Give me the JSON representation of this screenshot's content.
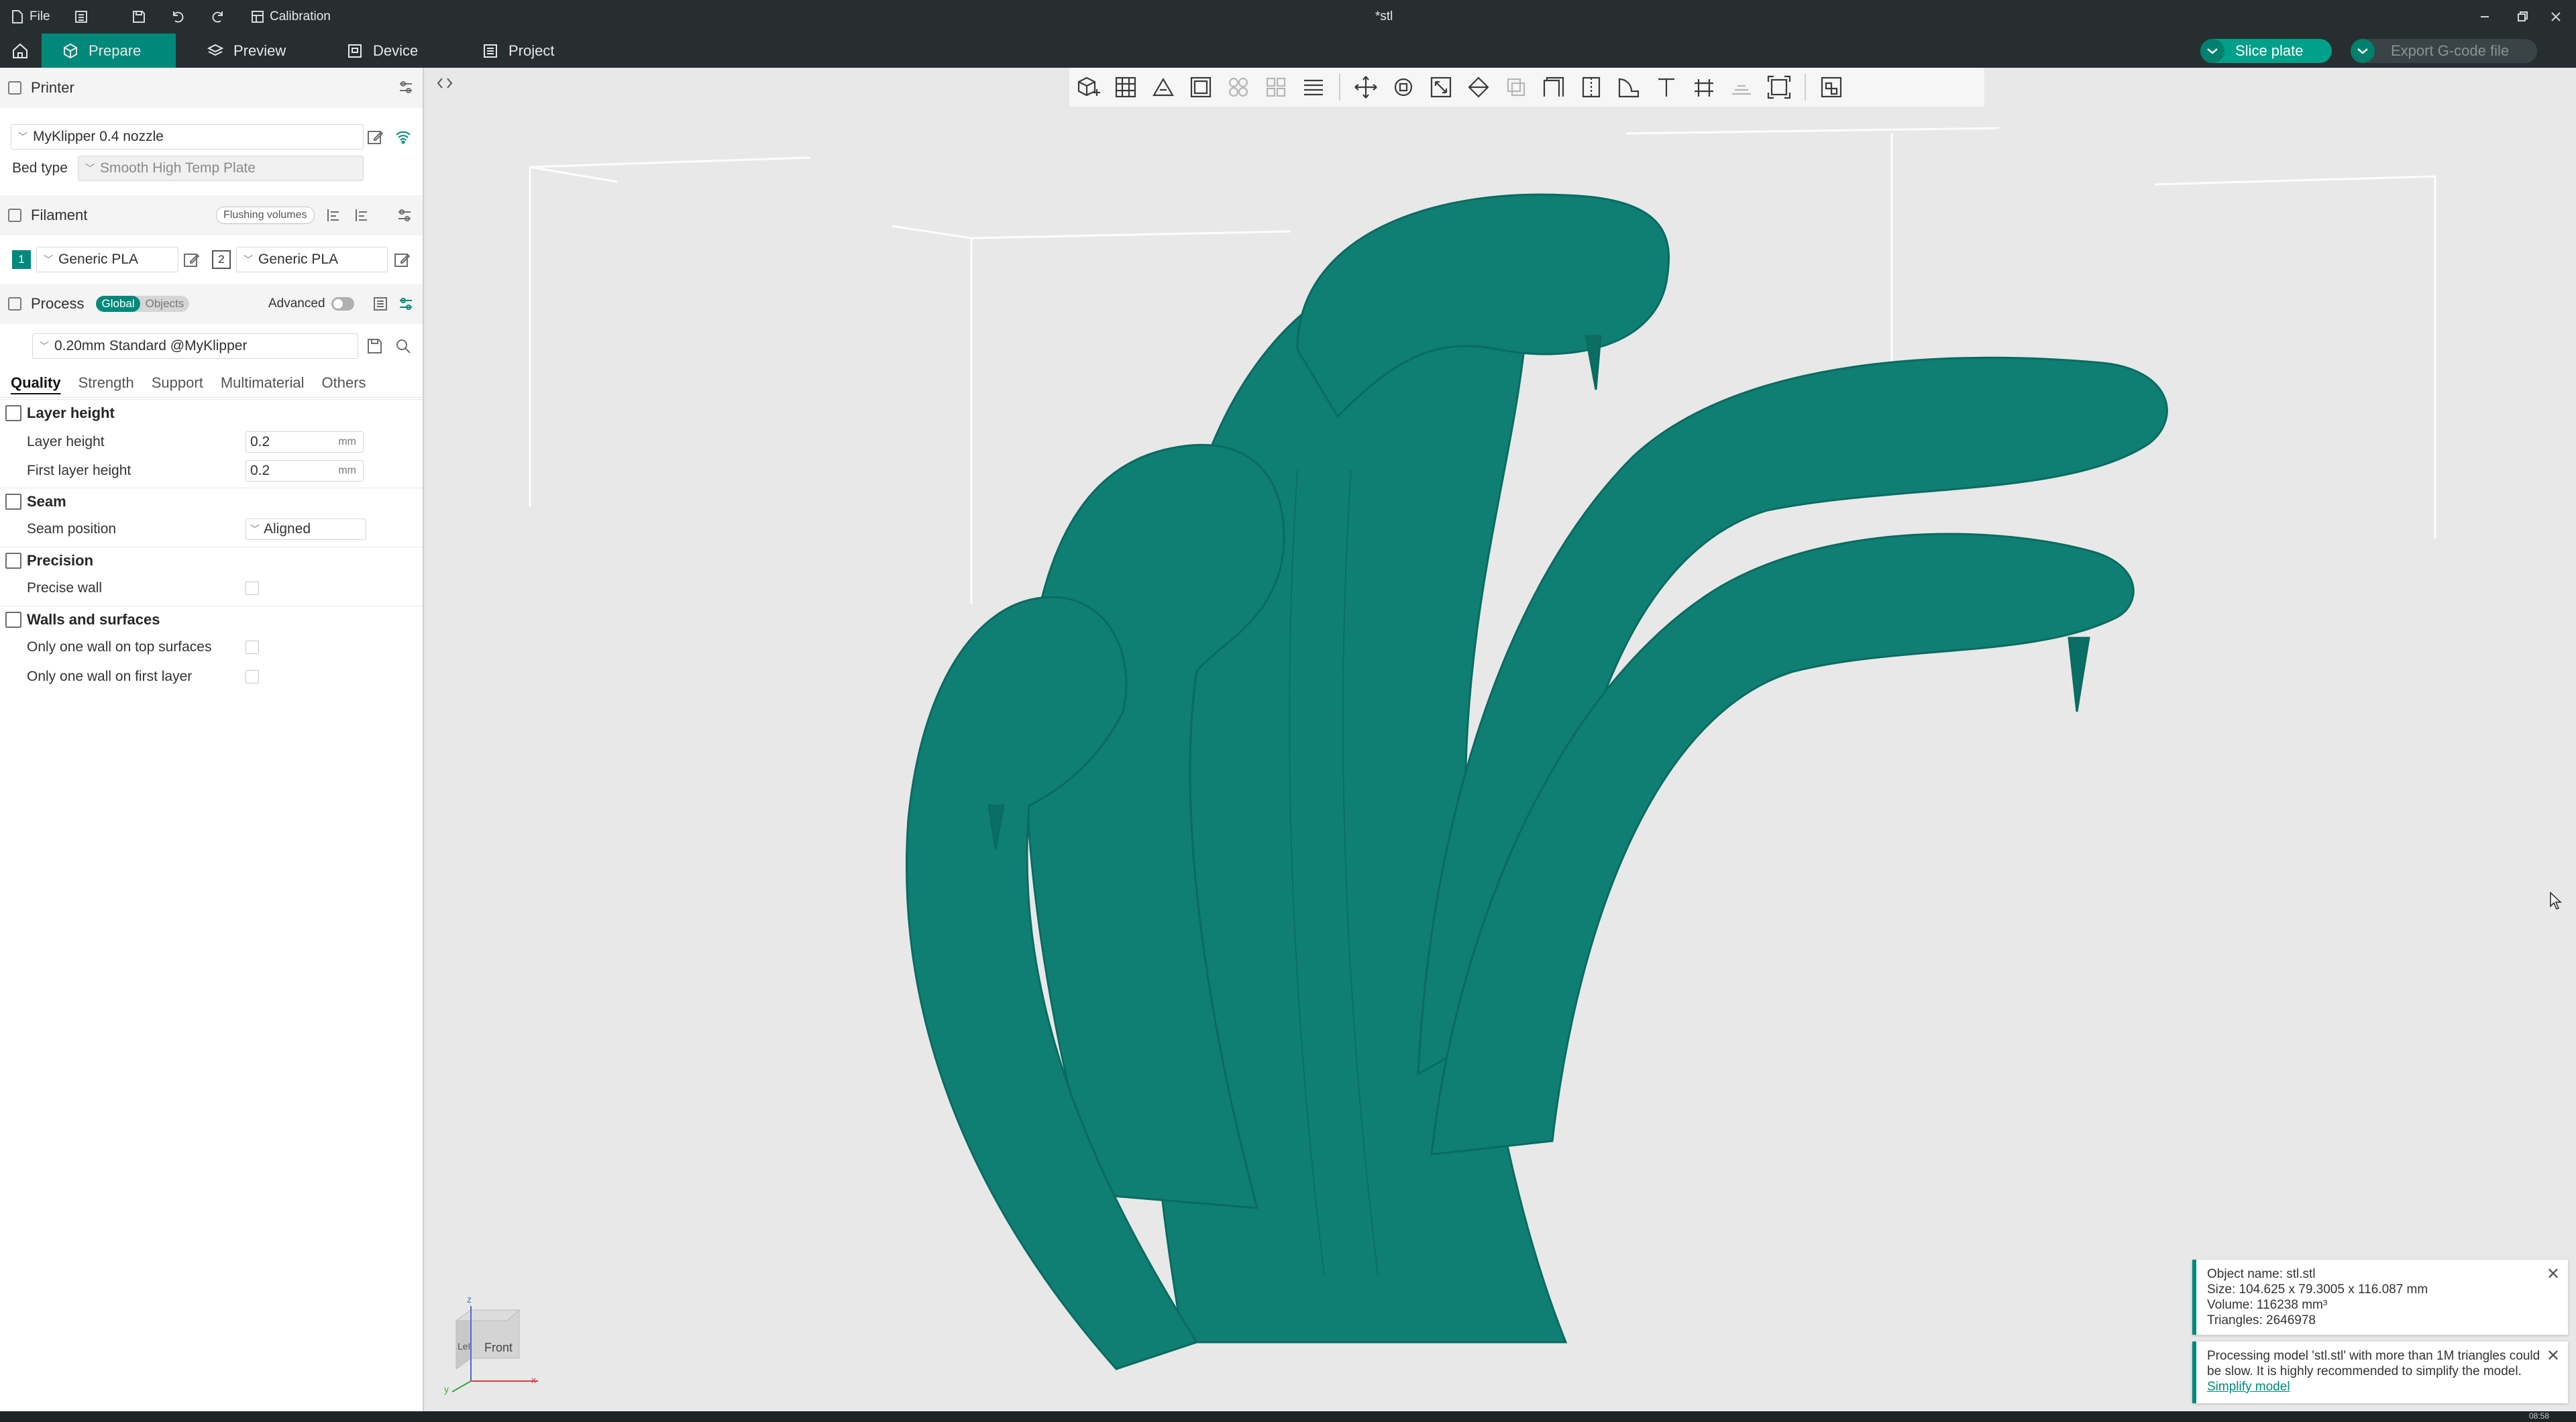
{
  "titlebar": {
    "file_label": "File",
    "calibration_label": "Calibration",
    "window_title": "*stl"
  },
  "nav": {
    "tabs": [
      {
        "label": "Prepare",
        "icon": "cube-icon"
      },
      {
        "label": "Preview",
        "icon": "layers-icon"
      },
      {
        "label": "Device",
        "icon": "device-icon"
      },
      {
        "label": "Project",
        "icon": "project-icon"
      }
    ],
    "slice_label": "Slice plate",
    "export_label": "Export G-code file",
    "accent": "#00897a"
  },
  "printer": {
    "section_label": "Printer",
    "printer_name": "MyKlipper 0.4 nozzle",
    "bed_type_label": "Bed type",
    "bed_type_value": "Smooth High Temp Plate"
  },
  "filament": {
    "section_label": "Filament",
    "flushing_label": "Flushing volumes",
    "slots": [
      {
        "number": "1",
        "name": "Generic PLA",
        "color": "#00897a"
      },
      {
        "number": "2",
        "name": "Generic PLA",
        "color": "#ffffff"
      }
    ]
  },
  "process": {
    "section_label": "Process",
    "global_label": "Global",
    "objects_label": "Objects",
    "advanced_label": "Advanced",
    "preset": "0.20mm Standard @MyKlipper",
    "tabs": [
      "Quality",
      "Strength",
      "Support",
      "Multimaterial",
      "Others"
    ]
  },
  "quality": {
    "layer_height_group": "Layer height",
    "layer_height_label": "Layer height",
    "layer_height_value": "0.2",
    "first_layer_height_label": "First layer height",
    "first_layer_height_value": "0.2",
    "unit": "mm",
    "seam_group": "Seam",
    "seam_position_label": "Seam position",
    "seam_position_value": "Aligned",
    "precision_group": "Precision",
    "precise_wall_label": "Precise wall",
    "walls_group": "Walls and surfaces",
    "one_wall_top_label": "Only one wall on top surfaces",
    "one_wall_first_label": "Only one wall on first layer"
  },
  "viewcube": {
    "front_label": "Front",
    "left_label": "Left",
    "z_label": "z",
    "x_label": "x",
    "y_label": "y"
  },
  "notifications": {
    "object_name": "Object name: stl.stl",
    "size": "Size: 104.625 x 79.3005 x 116.087 mm",
    "volume": "Volume: 116238 mm³",
    "triangles": "Triangles: 2646978",
    "warning_text": "Processing model 'stl.stl' with more than 1M triangles could be slow. It is highly recommended to simplify the model.",
    "warning_link": "Simplify model"
  },
  "clock": "08:58"
}
